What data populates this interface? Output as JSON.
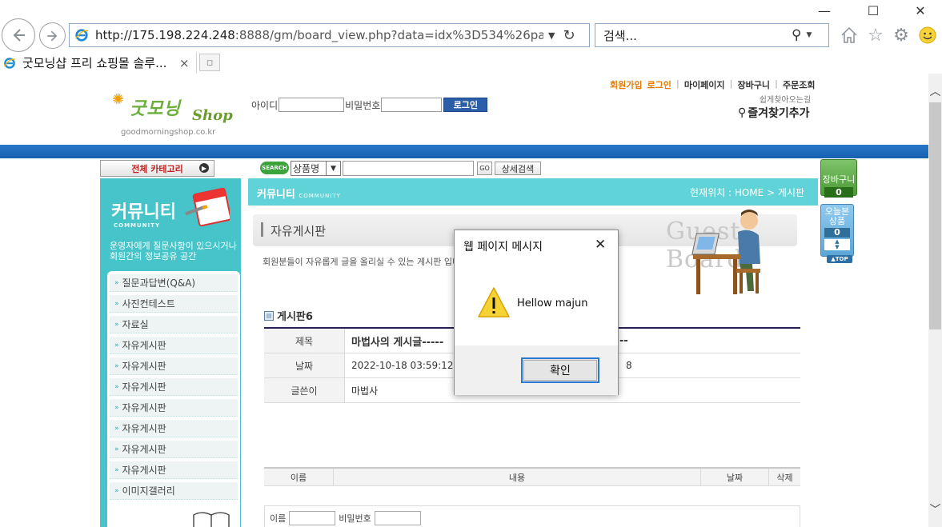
{
  "window": {
    "minimize_glyph": "—",
    "maximize_glyph": "☐",
    "close_glyph": "✕"
  },
  "browser": {
    "url_host": "http://175.198.224.248",
    "url_rest": ":8888/gm/board_view.php?data=idx%3D534%26pagecnt%3D",
    "search_placeholder": "검색...",
    "tab_title": "굿모닝샵 프리 쇼핑몰 솔루...",
    "tab_close": "×",
    "icons": [
      "back-icon",
      "forward-icon",
      "ie-icon",
      "dropdown-icon",
      "refresh-icon",
      "search-icon",
      "home-icon",
      "favorites-icon",
      "settings-icon",
      "smiley-icon",
      "new-tab-icon"
    ]
  },
  "header": {
    "logo_text": "굿모닝",
    "logo_shop": "Shop",
    "logo_domain": "goodmorningshop.co.kr",
    "id_label": "아이디",
    "pw_label": "비밀번호",
    "login_button": "로그인",
    "top_links": [
      "회원가입",
      "로그인",
      "마이페이지",
      "장바구니",
      "주문조회"
    ],
    "bookmark_sub": "쉽게찾아오는길",
    "bookmark_main": "즐겨찾기추가"
  },
  "search": {
    "all_category": "전체 카테고리",
    "badge": "SEARCH",
    "select_value": "상품명",
    "go_button": "GO",
    "detail_button": "상세검색"
  },
  "sidebar": {
    "title": "커뮤니티",
    "title_en": "COMMUNITY",
    "desc_line1": "운영자에게 질문사항이 있으시거나",
    "desc_line2": "회원간의 정보공유 공간",
    "items": [
      "질문과답변(Q&A)",
      "사진컨테스트",
      "자료실",
      "자유게시판",
      "자유게시판",
      "자유게시판",
      "자유게시판",
      "자유게시판",
      "자유게시판",
      "자유게시판",
      "이미지갤러리"
    ]
  },
  "content": {
    "community_label": "커뮤니티",
    "community_label_en": "COMMUNITY",
    "breadcrumb": "현재위치 : HOME > 게시판",
    "board_title": "자유게시판",
    "guest_board": "Guest Board",
    "board_desc": "회원분들이 자유롭게 글을 올리실 수 있는 게시판 입니",
    "board_name": "게시판6",
    "rows": [
      {
        "label": "제목",
        "value": "마법사의 게시글-----",
        "extra": "--"
      },
      {
        "label": "날짜",
        "value": "2022-10-18 03:59:12",
        "extra": "8"
      },
      {
        "label": "글쓴이",
        "value": "마법사",
        "extra": ""
      }
    ],
    "comment_columns": [
      "이름",
      "내용",
      "날짜",
      "삭제"
    ],
    "comment_form": {
      "name_label": "이름",
      "pw_label": "비밀번호"
    }
  },
  "widgets": {
    "cart_label": "장바구니",
    "cart_count": "0",
    "recent_label_1": "오늘본",
    "recent_label_2": "상품",
    "recent_count": "0",
    "top_label": "▲TOP"
  },
  "dialog": {
    "title": "웹 페이지 메시지",
    "message": "Hellow majun",
    "ok_button": "확인",
    "close_glyph": "✕"
  }
}
